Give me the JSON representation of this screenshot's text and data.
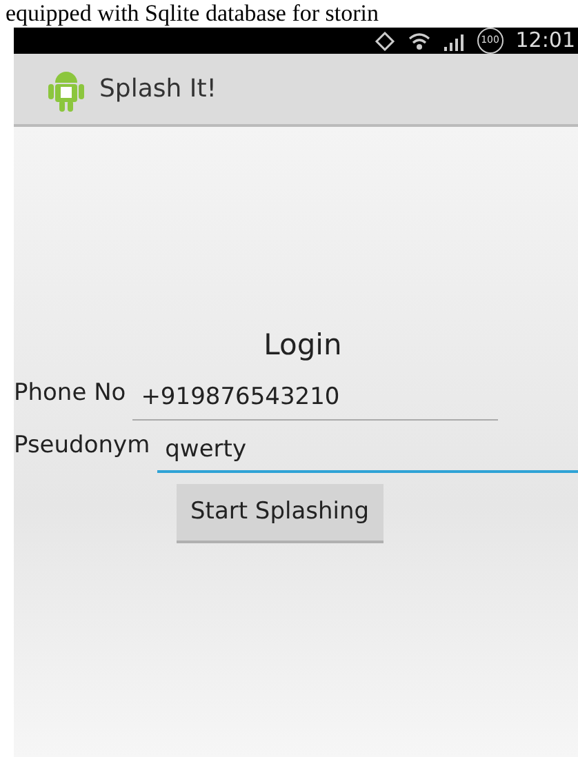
{
  "caption": "equipped with Sqlite database for storin",
  "status_bar": {
    "time": "12:01",
    "battery": "100"
  },
  "action_bar": {
    "title": "Splash It!"
  },
  "form": {
    "heading": "Login",
    "fields": [
      {
        "label": "Phone No",
        "value": "+919876543210",
        "focused": false
      },
      {
        "label": "Pseudonym",
        "value": "qwerty",
        "focused": true
      }
    ],
    "button": "Start Splashing"
  }
}
